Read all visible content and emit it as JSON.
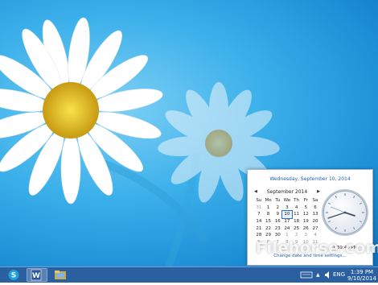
{
  "calendar_popup": {
    "long_date": "Wednesday, September 10, 2014",
    "month_label": "September 2014",
    "weekdays": [
      "Su",
      "Mo",
      "Tu",
      "We",
      "Th",
      "Fr",
      "Sa"
    ],
    "days": [
      "31",
      "1",
      "2",
      "3",
      "4",
      "5",
      "6",
      "7",
      "8",
      "9",
      "10",
      "11",
      "12",
      "13",
      "14",
      "15",
      "16",
      "17",
      "18",
      "19",
      "20",
      "21",
      "22",
      "23",
      "24",
      "25",
      "26",
      "27",
      "28",
      "29",
      "30",
      "1",
      "2",
      "3",
      "4",
      "5",
      "6",
      "7",
      "8",
      "9",
      "10",
      "11"
    ],
    "selected_day": "10",
    "clock_time": "1:39:48 PM",
    "change_link": "Change date and time settings..."
  },
  "taskbar": {
    "tray_language": "ENG",
    "tray_time": "1:39 PM",
    "tray_date": "9/10/2014",
    "apps": [
      {
        "name": "Skype",
        "letter": "S",
        "color": "#1fa0e0"
      },
      {
        "name": "Word",
        "letter": "W",
        "color": "#2b5797"
      },
      {
        "name": "Explorer",
        "letter": "",
        "color": "#d8a93a"
      }
    ]
  },
  "watermark": "Filehorse.com"
}
